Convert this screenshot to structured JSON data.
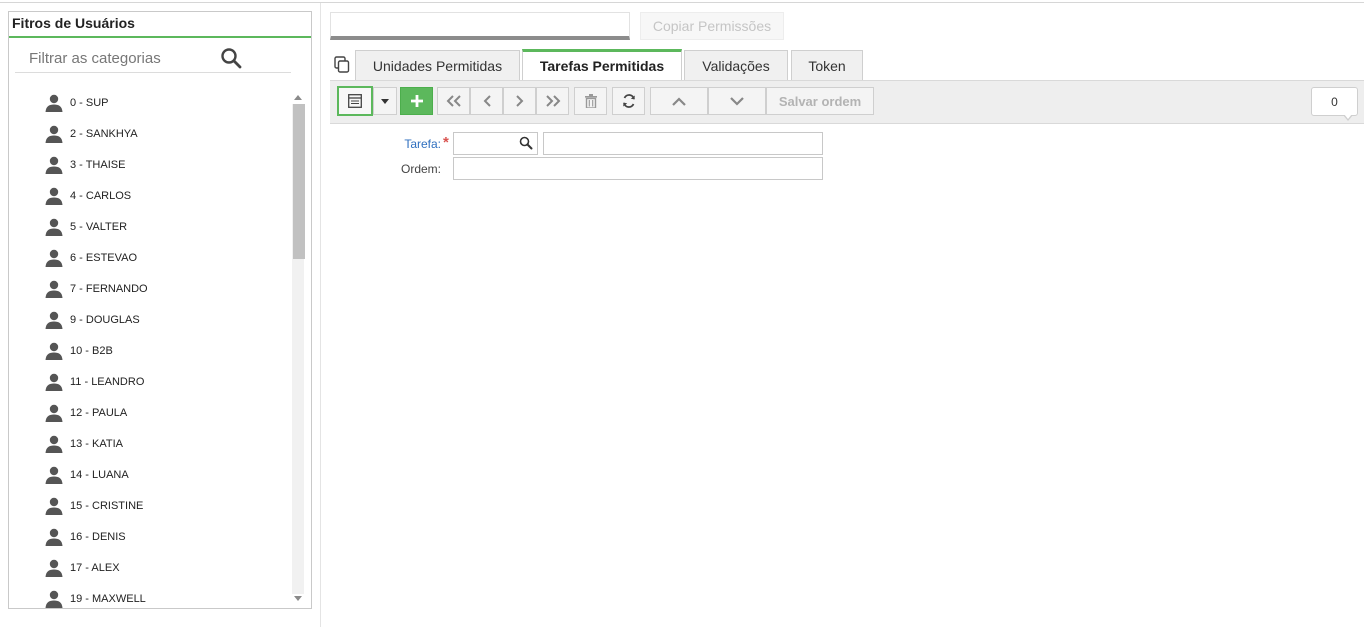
{
  "left_panel": {
    "title": "Fitros de Usuários",
    "filter_placeholder": "Filtrar as categorias",
    "users": [
      "0 - SUP",
      "2 - SANKHYA",
      "3 - THAISE",
      "4 - CARLOS",
      "5 - VALTER",
      "6 - ESTEVAO",
      "7 - FERNANDO",
      "9 - DOUGLAS",
      "10 - B2B",
      "11 - LEANDRO",
      "12 - PAULA",
      "13 - KATIA",
      "14 - LUANA",
      "15 - CRISTINE",
      "16 - DENIS",
      "17 - ALEX",
      "19 - MAXWELL"
    ]
  },
  "header": {
    "copy_permissions_label": "Copiar Permissões"
  },
  "tabs": [
    {
      "label": "Unidades Permitidas"
    },
    {
      "label": "Tarefas Permitidas",
      "active": true
    },
    {
      "label": "Validações"
    },
    {
      "label": "Token"
    }
  ],
  "toolbar": {
    "save_order_label": "Salvar ordem",
    "record_count": "0"
  },
  "form": {
    "tarefa_label": "Tarefa:",
    "required_mark": "*",
    "ordem_label": "Ordem:"
  },
  "colors": {
    "accent_green": "#5cb85c",
    "link_blue": "#2f6fbf",
    "required_red": "#d9534f"
  }
}
